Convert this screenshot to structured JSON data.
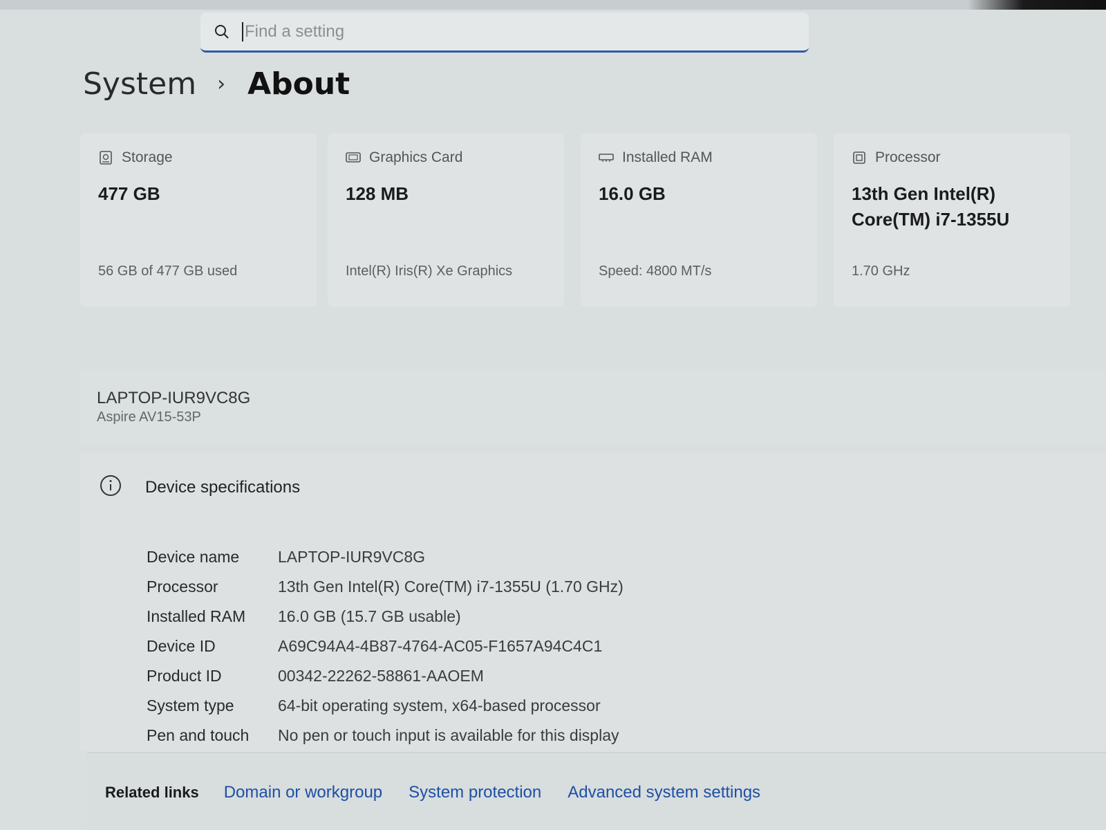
{
  "search": {
    "placeholder": "Find a setting",
    "icon": "search-icon"
  },
  "breadcrumb": {
    "parent": "System",
    "separator": "›",
    "current": "About"
  },
  "cards": [
    {
      "icon": "storage-icon",
      "label": "Storage",
      "value_lines": [
        "477 GB"
      ],
      "sub": "56 GB of 477 GB used"
    },
    {
      "icon": "graphics-card-icon",
      "label": "Graphics Card",
      "value_lines": [
        "128 MB"
      ],
      "sub": "Intel(R) Iris(R) Xe Graphics"
    },
    {
      "icon": "ram-icon",
      "label": "Installed RAM",
      "value_lines": [
        "16.0 GB"
      ],
      "sub": "Speed: 4800 MT/s"
    },
    {
      "icon": "processor-icon",
      "label": "Processor",
      "value_lines": [
        "13th Gen Intel(R)",
        "Core(TM) i7-1355U"
      ],
      "sub": "1.70 GHz"
    }
  ],
  "device": {
    "name": "LAPTOP-IUR9VC8G",
    "model": "Aspire AV15-53P"
  },
  "specs": {
    "title": "Device specifications",
    "icon": "info-icon",
    "rows": [
      {
        "key": "Device name",
        "value": "LAPTOP-IUR9VC8G"
      },
      {
        "key": "Processor",
        "value": "13th Gen Intel(R) Core(TM) i7-1355U (1.70 GHz)"
      },
      {
        "key": "Installed RAM",
        "value": "16.0 GB (15.7 GB usable)"
      },
      {
        "key": "Device ID",
        "value": "A69C94A4-4B87-4764-AC05-F1657A94C4C1"
      },
      {
        "key": "Product ID",
        "value": "00342-22262-58861-AAOEM"
      },
      {
        "key": "System type",
        "value": "64-bit operating system, x64-based processor"
      },
      {
        "key": "Pen and touch",
        "value": "No pen or touch input is available for this display"
      }
    ]
  },
  "related": {
    "label": "Related links",
    "links": [
      "Domain or workgroup",
      "System protection",
      "Advanced system settings"
    ]
  },
  "colors": {
    "accent": "#2f5aa8",
    "link": "#1d4fa5",
    "background": "#d9dedf"
  }
}
